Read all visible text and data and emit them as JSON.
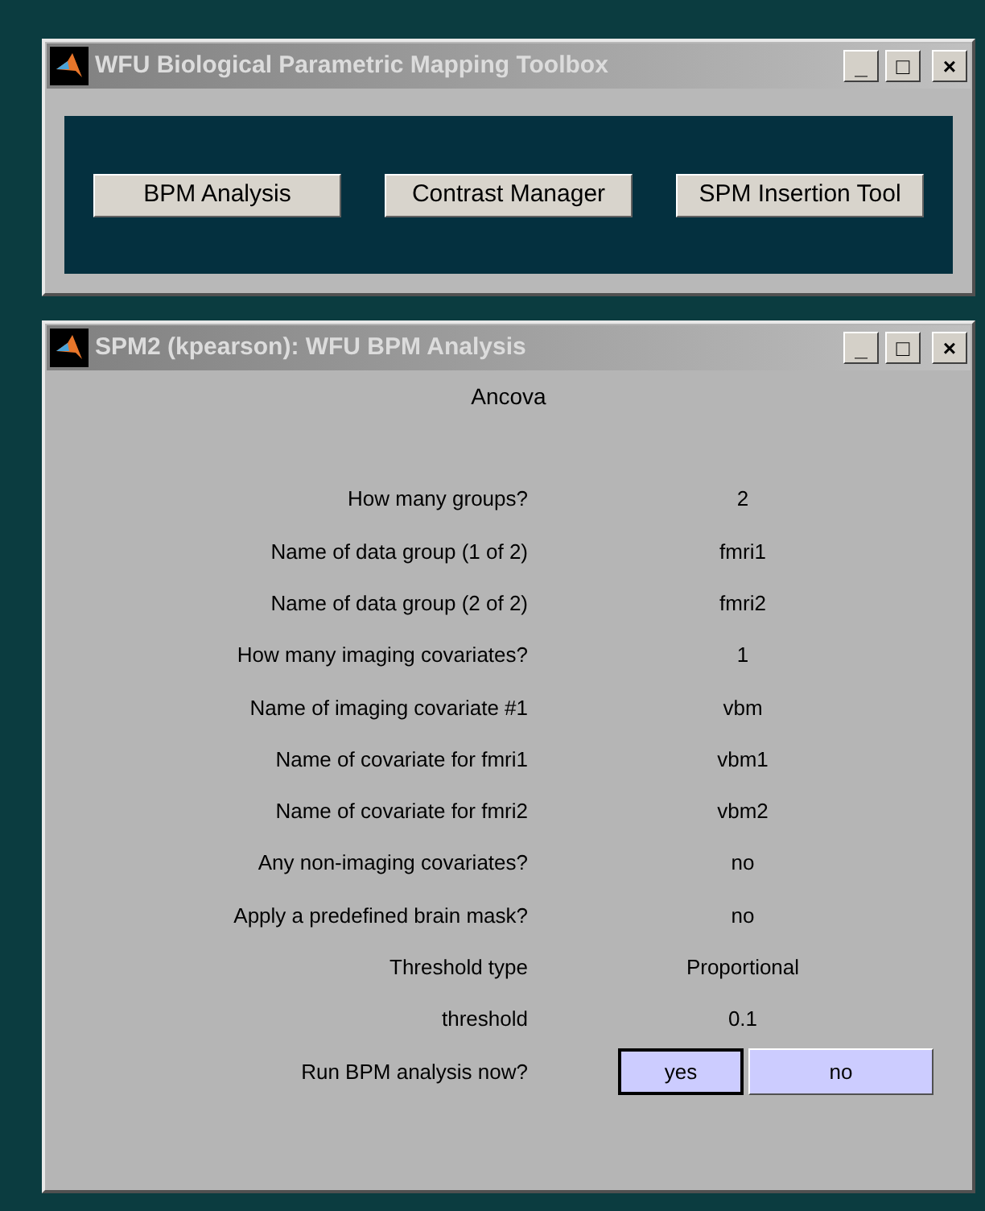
{
  "toolbox_window": {
    "title": "WFU Biological Parametric Mapping Toolbox",
    "title_buttons": [
      "_",
      "□",
      "×"
    ],
    "buttons": [
      "BPM Analysis",
      "Contrast Manager",
      "SPM Insertion Tool"
    ]
  },
  "analysis_window": {
    "title": "SPM2 (kpearson): WFU BPM Analysis",
    "title_buttons": [
      "_",
      "□",
      "×"
    ],
    "heading": "Ancova",
    "rows": [
      {
        "kind": "value",
        "label": "How many groups?",
        "value": "2"
      },
      {
        "kind": "value",
        "label": "Name of data group (1 of 2)",
        "value": "fmri1"
      },
      {
        "kind": "value",
        "label": "Name of data group (2 of 2)",
        "value": "fmri2"
      },
      {
        "kind": "value",
        "label": "How many imaging covariates?",
        "value": "1"
      },
      {
        "kind": "value",
        "label": "Name of imaging covariate #1",
        "value": "vbm"
      },
      {
        "kind": "value",
        "label": "Name of covariate for fmri1",
        "value": "vbm1"
      },
      {
        "kind": "value",
        "label": "Name of covariate for fmri2",
        "value": "vbm2"
      },
      {
        "kind": "value",
        "label": "Any non-imaging covariates?",
        "value": "no"
      },
      {
        "kind": "value",
        "label": "Apply a predefined brain mask?",
        "value": "no"
      },
      {
        "kind": "value",
        "label": "Threshold type",
        "value": "Proportional"
      },
      {
        "kind": "value",
        "label": "threshold",
        "value": "0.1"
      },
      {
        "kind": "choice",
        "label": "Run BPM analysis now?",
        "options": [
          {
            "label": "yes",
            "focused": true
          },
          {
            "label": "no",
            "focused": false
          }
        ]
      }
    ]
  }
}
